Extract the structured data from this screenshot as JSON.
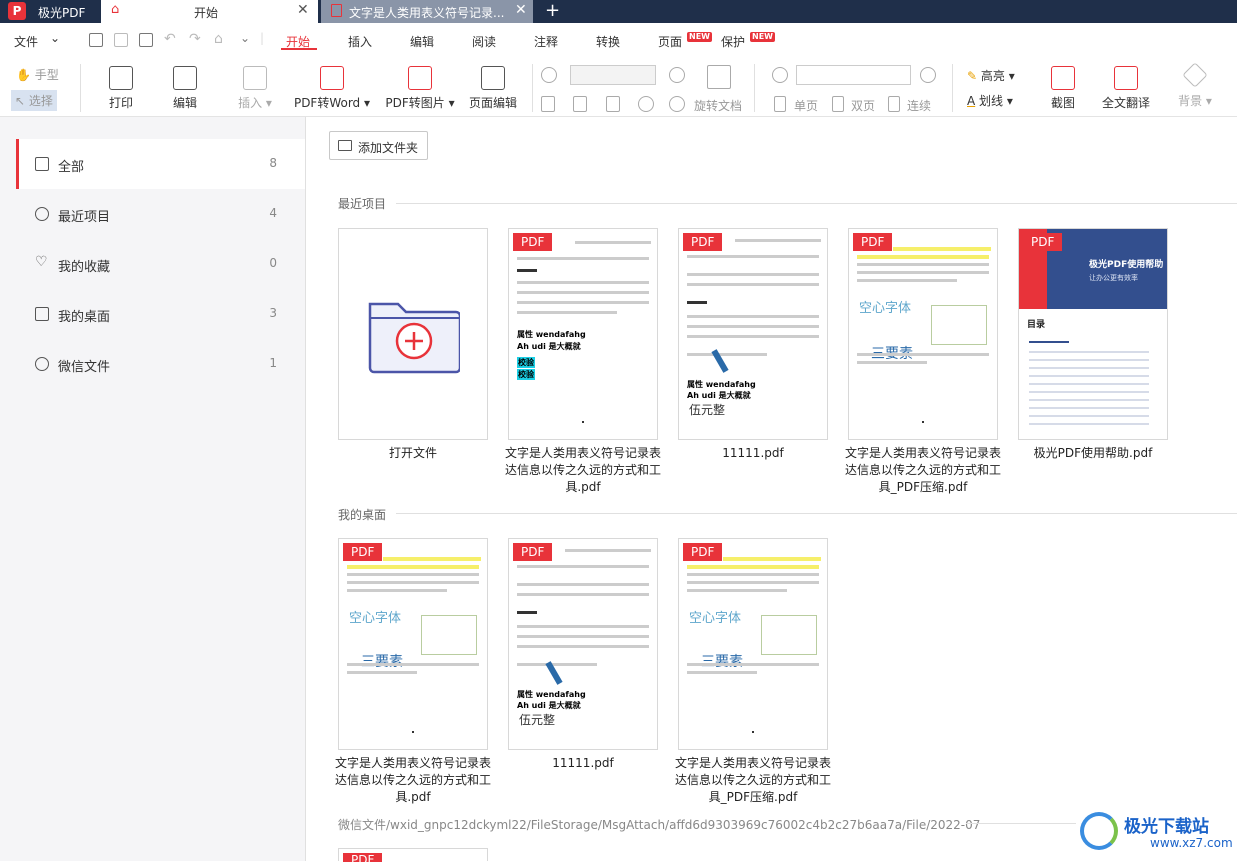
{
  "app": {
    "title": "极光PDF",
    "logo": "P"
  },
  "tabs": [
    {
      "label": "开始",
      "icon": "home-icon",
      "active": true
    },
    {
      "label": "文字是人类用表义符号记录...",
      "icon": "pdf-file-icon",
      "active": false
    }
  ],
  "menu": {
    "file": "文件",
    "items": [
      "开始",
      "插入",
      "编辑",
      "阅读",
      "注释",
      "转换",
      "页面",
      "保护"
    ],
    "active": "开始",
    "new_badge": "NEW"
  },
  "toolbar": {
    "hand": "手型",
    "select": "选择",
    "print": "打印",
    "edit": "编辑",
    "insert": "插入",
    "pdf_to_word": "PDF转Word",
    "pdf_to_image": "PDF转图片",
    "page_edit": "页面编辑",
    "rotate": "旋转文档",
    "single": "单页",
    "double": "双页",
    "continuous": "连续",
    "highlight": "高亮",
    "strikeout": "划线",
    "screenshot": "截图",
    "translate": "全文翻译",
    "background": "背景"
  },
  "sidebar": {
    "items": [
      {
        "label": "全部",
        "count": "8",
        "icon": "grid-icon"
      },
      {
        "label": "最近项目",
        "count": "4",
        "icon": "clock-icon"
      },
      {
        "label": "我的收藏",
        "count": "0",
        "icon": "heart-icon"
      },
      {
        "label": "我的桌面",
        "count": "3",
        "icon": "desktop-icon"
      },
      {
        "label": "微信文件",
        "count": "1",
        "icon": "wechat-icon"
      }
    ]
  },
  "main": {
    "add_folder": "添加文件夹",
    "recent_title": "最近项目",
    "desktop_title": "我的桌面",
    "open_file": "打开文件",
    "pdf_badge": "PDF",
    "recent_files": [
      {
        "name": "文字是人类用表义符号记录表达信息以传之久远的方式和工具.pdf"
      },
      {
        "name": "11111.pdf"
      },
      {
        "name": "文字是人类用表义符号记录表达信息以传之久远的方式和工具_PDF压缩.pdf"
      },
      {
        "name": "极光PDF使用帮助.pdf"
      }
    ],
    "desktop_files": [
      {
        "name": "文字是人类用表义符号记录表达信息以传之久远的方式和工具.pdf"
      },
      {
        "name": "11111.pdf"
      },
      {
        "name": "文字是人类用表义符号记录表达信息以传之久远的方式和工具_PDF压缩.pdf"
      }
    ],
    "wechat_path": "微信文件/wxid_gnpc12dckyml22/FileStorage/MsgAttach/affd6d9303969c76002c4b2c27b6aa7a/File/2022-07"
  },
  "thumb_text": {
    "hollow_font": "空心字体",
    "three_elements": "三要素",
    "bold_line": "属性 wendafahg",
    "bold_line2": "Ah udi 是大概就",
    "serif_line": "伍元整",
    "cyan_tag": "校验",
    "help_title": "极光PDF使用帮助",
    "help_sub": "让办公更有效率",
    "help_toc": "目录"
  },
  "watermark": {
    "title": "极光下载站",
    "url": "www.xz7.com"
  },
  "colors": {
    "accent": "#e8333a",
    "titlebar": "#1f2f4a",
    "sidebar_bg": "#f5f5f7"
  }
}
